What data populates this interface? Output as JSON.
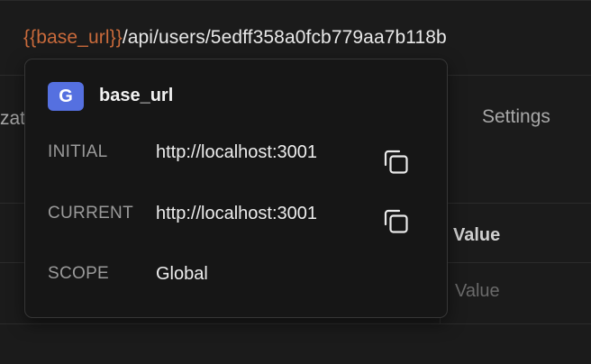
{
  "url_bar": {
    "variable": "{{base_url}}",
    "path": "/api/users/5edff358a0fcb779aa7b118b"
  },
  "tabs": {
    "partial_label": "zat",
    "settings_label": "Settings"
  },
  "table": {
    "value_header": "Value",
    "value_placeholder": "Value"
  },
  "popover": {
    "badge": "G",
    "variable_name": "base_url",
    "rows": [
      {
        "label": "INITIAL",
        "value": "http://localhost:3001",
        "copyable": true
      },
      {
        "label": "CURRENT",
        "value": "http://localhost:3001",
        "copyable": true
      },
      {
        "label": "SCOPE",
        "value": "Global",
        "copyable": false
      }
    ],
    "copy_icon": "copy-icon"
  },
  "colors": {
    "variable_orange": "#c96a3b",
    "badge_blue": "#5570e0",
    "background": "#1b1b1b",
    "popover_bg": "#161616"
  }
}
